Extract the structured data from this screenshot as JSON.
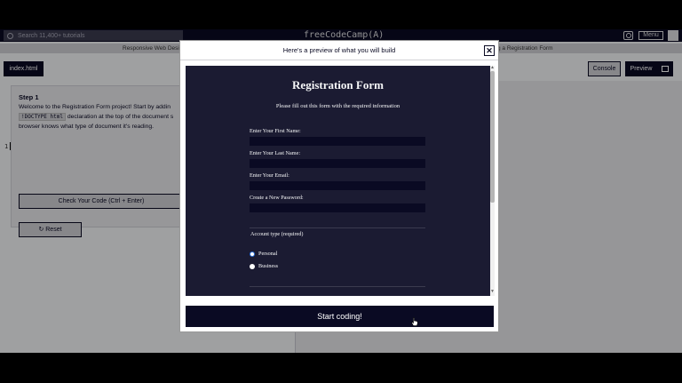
{
  "navbar": {
    "search_placeholder": "Search 11,400+ tutorials",
    "brand": "freeCodeCamp(A)",
    "menu_label": "Menu"
  },
  "breadcrumbs": {
    "left": "Responsive Web Desig",
    "right": "g a Registration Form"
  },
  "editor": {
    "file_tab": "index.html",
    "line_number": "1"
  },
  "toolbar": {
    "console_label": "Console",
    "preview_label": "Preview"
  },
  "step": {
    "title": "Step 1",
    "text_before": "Welcome to the Registration Form project! Start by addin",
    "code": "!DOCTYPE html",
    "text_after": " declaration at the top of the document s",
    "text_last": "browser knows what type of document it's reading.",
    "check_label": "Check Your Code (Ctrl + Enter)",
    "reset_label": "Reset"
  },
  "modal": {
    "header": "Here's a preview of what you will build",
    "close_symbol": "✕",
    "start_label": "Start coding!"
  },
  "preview_form": {
    "title": "Registration Form",
    "description": "Please fill out this form with the required information",
    "fields": [
      {
        "label": "Enter Your First Name:"
      },
      {
        "label": "Enter Your Last Name:"
      },
      {
        "label": "Enter Your Email:"
      },
      {
        "label": "Create a New Password:"
      }
    ],
    "account_legend": "Account type (required)",
    "options": [
      {
        "label": "Personal",
        "checked": true
      },
      {
        "label": "Business",
        "checked": false
      }
    ]
  },
  "colors": {
    "fcc_dark": "#0a0a23",
    "preview_bg": "#1b1b32",
    "radio_accent": "#2a6fdb"
  }
}
